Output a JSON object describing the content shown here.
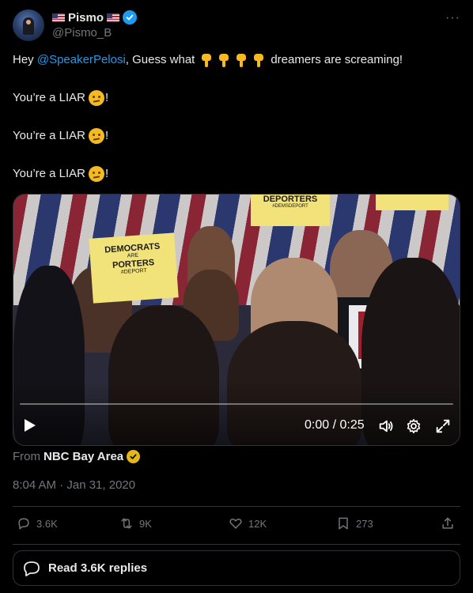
{
  "author": {
    "display_name": "Pismo",
    "handle": "@Pismo_B",
    "more_label": "···"
  },
  "tweet": {
    "line1_prefix": "Hey ",
    "mention": "@SpeakerPelosi",
    "line1_mid": ", Guess what",
    "line1_suffix": "dreamers are screaming!",
    "liar_text_1": "You’re a LIAR",
    "liar_text_2": "You’re a LIAR",
    "liar_text_3": "You’re a LIAR",
    "bang": "!"
  },
  "video": {
    "time": "0:00 / 0:25",
    "progress": 0,
    "sign1_line1": "DEMOCRATS",
    "sign1_line2": "ARE",
    "sign1_line3": "PORTERS",
    "sign1_line4": "#DEPORT",
    "sign2_line1": "DEPORTERS",
    "sign2_line2": "#DEMSDEPORT"
  },
  "source": {
    "from_label": "From",
    "name": "NBC Bay Area"
  },
  "timestamp": "8:04 AM · Jan 31, 2020",
  "stats": {
    "replies": "3.6K",
    "retweets": "9K",
    "likes": "12K",
    "bookmarks": "273"
  },
  "read_replies": "Read 3.6K replies",
  "colors": {
    "accent": "#1d9bf0",
    "muted": "#71767b",
    "gold": "#e2b719"
  }
}
